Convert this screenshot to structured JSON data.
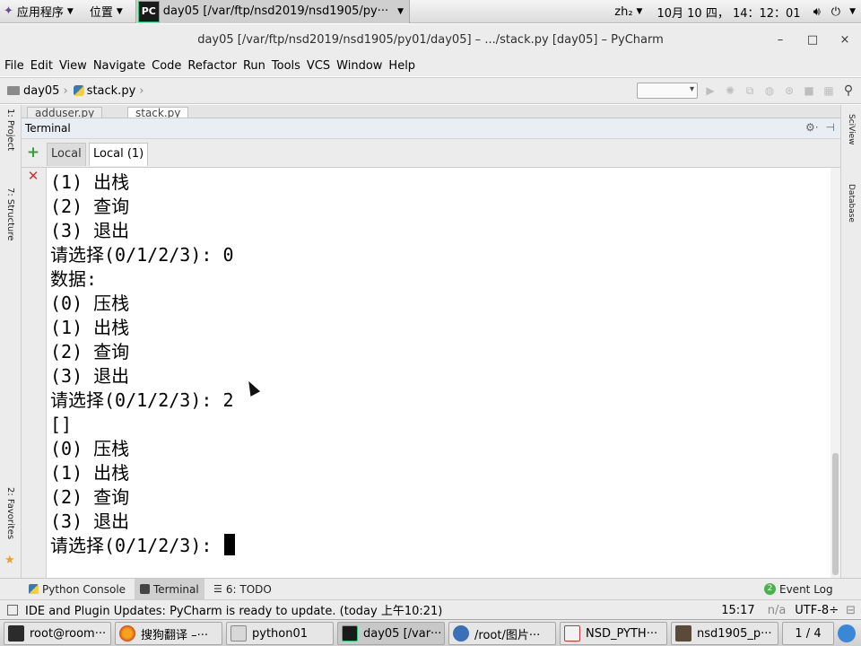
{
  "topbar": {
    "apps_menu": "应用程序",
    "places_menu": "位置",
    "active_window": "day05 [/var/ftp/nsd2019/nsd1905/py···",
    "input_method": "zh₂",
    "clock": "10月 10 四， 14：12：01"
  },
  "window": {
    "title": "day05 [/var/ftp/nsd2019/nsd1905/py01/day05] – .../stack.py [day05] – PyCharm",
    "minimize": "–",
    "maximize": "□",
    "close": "×"
  },
  "menu": [
    "File",
    "Edit",
    "View",
    "Navigate",
    "Code",
    "Refactor",
    "Run",
    "Tools",
    "VCS",
    "Window",
    "Help"
  ],
  "breadcrumb": {
    "project": "day05",
    "file": "stack.py"
  },
  "editor_tabs": [
    "adduser.py",
    "stack.py"
  ],
  "left_strip": {
    "project_tab": "1: Project",
    "structure_tab": "7: Structure",
    "favorites_tab": "2: Favorites"
  },
  "right_strip": {
    "scview_tab": "SciView",
    "database_tab": "Database"
  },
  "terminal": {
    "header": "Terminal",
    "tabs": [
      "Local",
      "Local (1)"
    ],
    "lines": [
      "(1) 出栈",
      "(2) 查询",
      "(3) 退出",
      "请选择(0/1/2/3): 0",
      "数据:",
      "(0) 压栈",
      "(1) 出栈",
      "(2) 查询",
      "(3) 退出",
      "请选择(0/1/2/3): 2",
      "[]",
      "(0) 压栈",
      "(1) 出栈",
      "(2) 查询",
      "(3) 退出",
      "请选择(0/1/2/3): "
    ]
  },
  "bottom_tools": {
    "python_console": "Python Console",
    "terminal": "Terminal",
    "todo": "6: TODO",
    "event_log": "Event Log",
    "event_badge": "2"
  },
  "status": {
    "message": "IDE and Plugin Updates: PyCharm is ready to update. (today 上午10:21)",
    "position": "15:17",
    "na": "n/a",
    "encoding": "UTF-8÷"
  },
  "taskbar": {
    "items": [
      "root@room···",
      "搜狗翻译 –···",
      "python01",
      "day05 [/var···",
      "/root/图片···",
      "NSD_PYTH···",
      "nsd1905_p···"
    ],
    "workspace": "1 / 4"
  },
  "colors": {
    "pycharm_green": "#22c97a",
    "selection_gray": "#cfcfcf",
    "terminal_bg": "#ffffff"
  }
}
